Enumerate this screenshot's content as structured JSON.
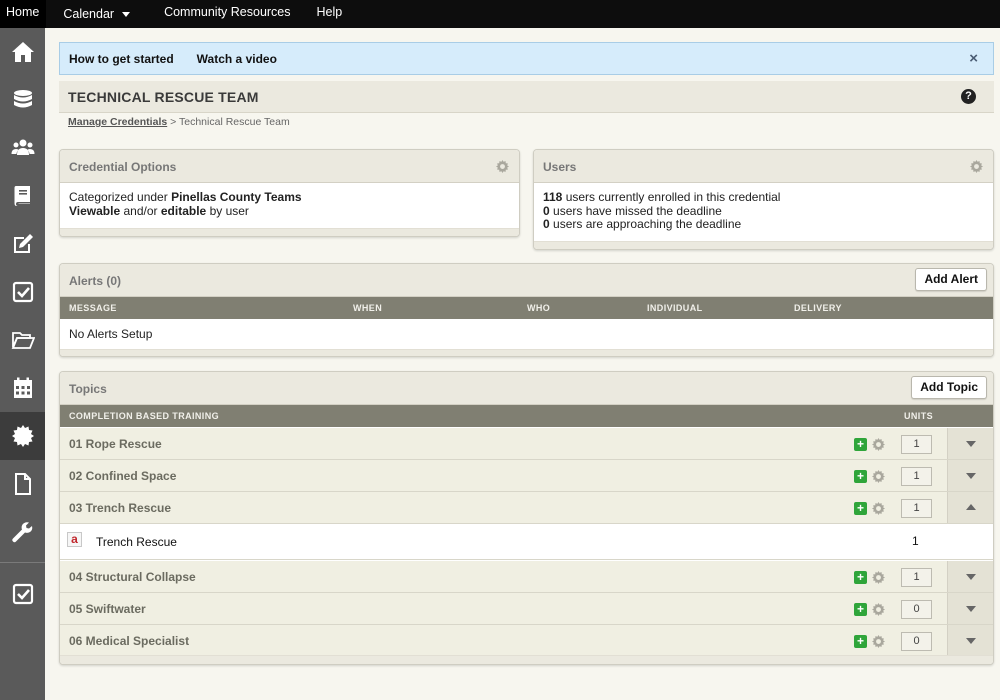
{
  "topnav": {
    "home": "Home",
    "calendar": "Calendar",
    "community": "Community Resources",
    "help": "Help"
  },
  "sidebar": {
    "items": [
      {
        "icon": "home-icon"
      },
      {
        "icon": "database-icon"
      },
      {
        "icon": "users-icon"
      },
      {
        "icon": "book-icon"
      },
      {
        "icon": "edit-icon"
      },
      {
        "icon": "checkbox-icon"
      },
      {
        "icon": "folder-open-icon"
      },
      {
        "icon": "calendar-icon"
      },
      {
        "icon": "certificate-icon",
        "active": true
      },
      {
        "icon": "document-icon"
      },
      {
        "icon": "wrench-icon"
      },
      {
        "icon": "checkbox-icon"
      }
    ]
  },
  "banner": {
    "get_started": "How to get started",
    "watch_video": "Watch a video",
    "close": "×"
  },
  "page": {
    "title": "TECHNICAL RESCUE TEAM",
    "help": "?"
  },
  "breadcrumb": {
    "link": "Manage Credentials",
    "separator": ">",
    "current": "Technical Rescue Team"
  },
  "credential_options": {
    "title": "Credential Options",
    "line1_prefix": "Categorized under",
    "line1_value": "Pinellas County Teams",
    "line2_a": "Viewable",
    "line2_mid": "and/or",
    "line2_b": "editable",
    "line2_suffix": "by user"
  },
  "users": {
    "title": "Users",
    "enrolled_count": "118",
    "enrolled_text": "users currently enrolled in this credential",
    "missed_count": "0",
    "missed_text": "users have missed the deadline",
    "approaching_count": "0",
    "approaching_text": "users are approaching the deadline"
  },
  "alerts": {
    "title": "Alerts (0)",
    "add_button": "Add Alert",
    "columns": [
      "MESSAGE",
      "WHEN",
      "WHO",
      "INDIVIDUAL",
      "DELIVERY"
    ],
    "empty": "No Alerts Setup"
  },
  "topics": {
    "title": "Topics",
    "add_button": "Add Topic",
    "col_training": "COMPLETION BASED TRAINING",
    "col_units": "UNITS",
    "rows": [
      {
        "name": "01 Rope Rescue",
        "units": "1",
        "expanded": false
      },
      {
        "name": "02 Confined Space",
        "units": "1",
        "expanded": false
      },
      {
        "name": "03 Trench Rescue",
        "units": "1",
        "expanded": true
      },
      {
        "name": "04 Structural Collapse",
        "units": "1",
        "expanded": false
      },
      {
        "name": "05 Swiftwater",
        "units": "0",
        "expanded": false
      },
      {
        "name": "06 Medical Specialist",
        "units": "0",
        "expanded": false
      }
    ],
    "expanded_item": {
      "icon_letter": "a",
      "name": "Trench Rescue",
      "units": "1"
    }
  },
  "colors": {
    "topnav_bg": "#0d0d0d",
    "sidebar_bg": "#5a5a5a",
    "banner_bg": "#d6ecfb",
    "table_header_bg": "#807f72",
    "topic_row_bg": "#f0efe2",
    "plus_green": "#2fa53a"
  }
}
